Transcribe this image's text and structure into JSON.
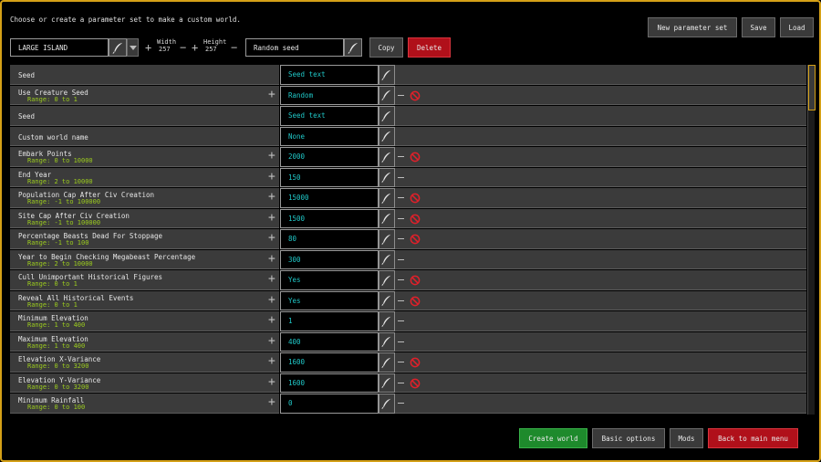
{
  "instructions": "Choose or create a parameter set to make a custom world.",
  "preset": {
    "value": "LARGE ISLAND"
  },
  "dimensions": {
    "width_label": "Width",
    "width_value": "257",
    "height_label": "Height",
    "height_value": "257"
  },
  "seed_field": {
    "value": "Random seed"
  },
  "buttons": {
    "copy": "Copy",
    "delete": "Delete",
    "new_parameter_set": "New parameter set",
    "save": "Save",
    "load": "Load",
    "create_world": "Create world",
    "basic_options": "Basic options",
    "mods": "Mods",
    "back": "Back to main menu"
  },
  "params": [
    {
      "name": "Seed",
      "range": "",
      "value": "Seed text",
      "plus": false,
      "minus": false,
      "block": false
    },
    {
      "name": "Use Creature Seed",
      "range": "Range: 0 to 1",
      "value": "Random",
      "plus": true,
      "minus": true,
      "block": true
    },
    {
      "name": "Seed",
      "range": "",
      "value": "Seed text",
      "plus": false,
      "minus": false,
      "block": false
    },
    {
      "name": "Custom world name",
      "range": "",
      "value": "None",
      "plus": false,
      "minus": false,
      "block": false
    },
    {
      "name": "Embark Points",
      "range": "Range: 0 to 10000",
      "value": "2000",
      "plus": true,
      "minus": true,
      "block": true
    },
    {
      "name": "End Year",
      "range": "Range: 2 to 10000",
      "value": "150",
      "plus": true,
      "minus": true,
      "block": false
    },
    {
      "name": "Population Cap After Civ Creation",
      "range": "Range: -1 to 100000",
      "value": "15000",
      "plus": true,
      "minus": true,
      "block": true
    },
    {
      "name": "Site Cap After Civ Creation",
      "range": "Range: -1 to 100000",
      "value": "1500",
      "plus": true,
      "minus": true,
      "block": true
    },
    {
      "name": "Percentage Beasts Dead For Stoppage",
      "range": "Range: -1 to 100",
      "value": "80",
      "plus": true,
      "minus": true,
      "block": true
    },
    {
      "name": "Year to Begin Checking Megabeast Percentage",
      "range": "Range: 2 to 10000",
      "value": "300",
      "plus": true,
      "minus": true,
      "block": false
    },
    {
      "name": "Cull Unimportant Historical Figures",
      "range": "Range: 0 to 1",
      "value": "Yes",
      "plus": true,
      "minus": true,
      "block": true
    },
    {
      "name": "Reveal All Historical Events",
      "range": "Range: 0 to 1",
      "value": "Yes",
      "plus": true,
      "minus": true,
      "block": true
    },
    {
      "name": "Minimum Elevation",
      "range": "Range: 1 to 400",
      "value": "1",
      "plus": true,
      "minus": true,
      "block": false
    },
    {
      "name": "Maximum Elevation",
      "range": "Range: 1 to 400",
      "value": "400",
      "plus": true,
      "minus": true,
      "block": false
    },
    {
      "name": "Elevation X-Variance",
      "range": "Range: 0 to 3200",
      "value": "1600",
      "plus": true,
      "minus": true,
      "block": true
    },
    {
      "name": "Elevation Y-Variance",
      "range": "Range: 0 to 3200",
      "value": "1600",
      "plus": true,
      "minus": true,
      "block": true
    },
    {
      "name": "Minimum Rainfall",
      "range": "Range: 0 to 100",
      "value": "0",
      "plus": true,
      "minus": true,
      "block": false
    }
  ],
  "icons": {
    "edit": "quill-icon",
    "disable": "no-sign-icon",
    "dropdown": "chevron-down-icon"
  }
}
